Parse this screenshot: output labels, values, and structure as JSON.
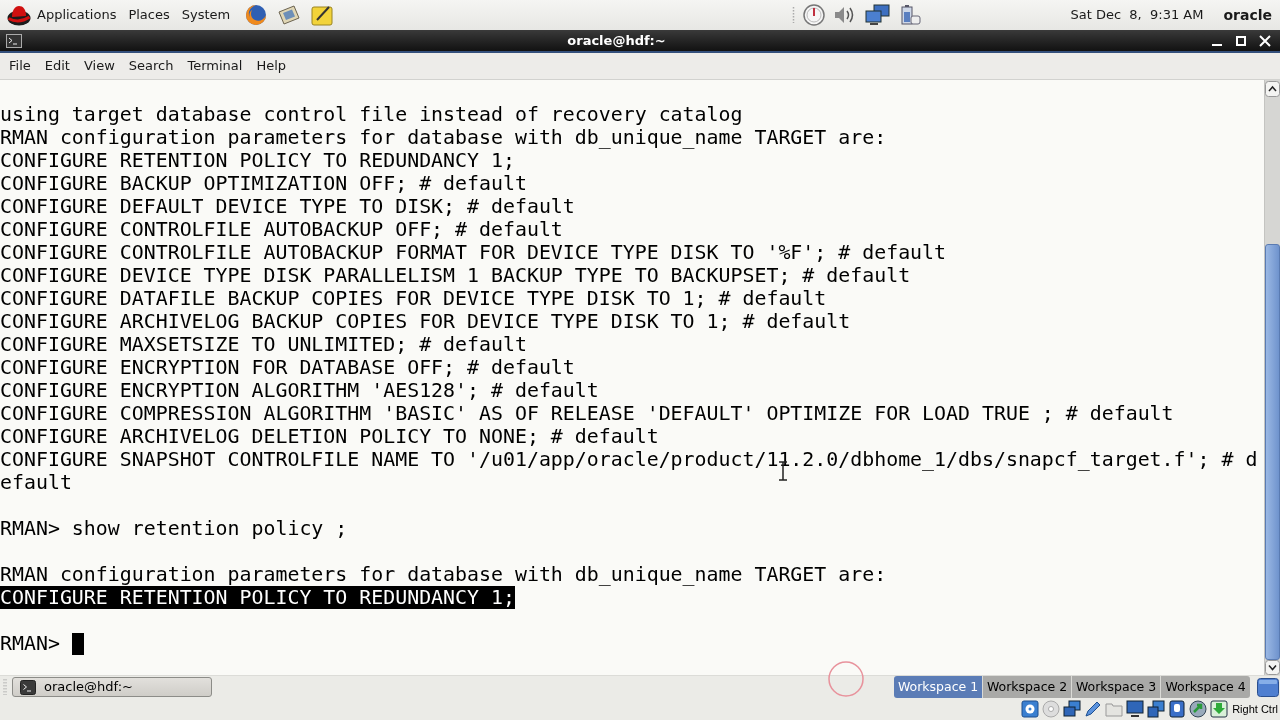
{
  "top_panel": {
    "menus": [
      "Applications",
      "Places",
      "System"
    ],
    "clock": "Sat Dec  8,  9:31 AM",
    "user": "oracle"
  },
  "window": {
    "title": "oracle@hdf:~"
  },
  "menu_bar": [
    "File",
    "Edit",
    "View",
    "Search",
    "Terminal",
    "Help"
  ],
  "terminal": {
    "lines": [
      {
        "kind": "text",
        "text": "using target database control file instead of recovery catalog",
        "selected": false
      },
      {
        "kind": "text",
        "text": "RMAN configuration parameters for database with db_unique_name TARGET are:",
        "selected": false
      },
      {
        "kind": "text",
        "text": "CONFIGURE RETENTION POLICY TO REDUNDANCY 1;",
        "selected": false
      },
      {
        "kind": "text",
        "text": "CONFIGURE BACKUP OPTIMIZATION OFF; # default",
        "selected": false
      },
      {
        "kind": "text",
        "text": "CONFIGURE DEFAULT DEVICE TYPE TO DISK; # default",
        "selected": false
      },
      {
        "kind": "text",
        "text": "CONFIGURE CONTROLFILE AUTOBACKUP OFF; # default",
        "selected": false
      },
      {
        "kind": "text",
        "text": "CONFIGURE CONTROLFILE AUTOBACKUP FORMAT FOR DEVICE TYPE DISK TO '%F'; # default",
        "selected": false
      },
      {
        "kind": "text",
        "text": "CONFIGURE DEVICE TYPE DISK PARALLELISM 1 BACKUP TYPE TO BACKUPSET; # default",
        "selected": false
      },
      {
        "kind": "text",
        "text": "CONFIGURE DATAFILE BACKUP COPIES FOR DEVICE TYPE DISK TO 1; # default",
        "selected": false
      },
      {
        "kind": "text",
        "text": "CONFIGURE ARCHIVELOG BACKUP COPIES FOR DEVICE TYPE DISK TO 1; # default",
        "selected": false
      },
      {
        "kind": "text",
        "text": "CONFIGURE MAXSETSIZE TO UNLIMITED; # default",
        "selected": false
      },
      {
        "kind": "text",
        "text": "CONFIGURE ENCRYPTION FOR DATABASE OFF; # default",
        "selected": false
      },
      {
        "kind": "text",
        "text": "CONFIGURE ENCRYPTION ALGORITHM 'AES128'; # default",
        "selected": false
      },
      {
        "kind": "text",
        "text": "CONFIGURE COMPRESSION ALGORITHM 'BASIC' AS OF RELEASE 'DEFAULT' OPTIMIZE FOR LOAD TRUE ; # default",
        "selected": false
      },
      {
        "kind": "text",
        "text": "CONFIGURE ARCHIVELOG DELETION POLICY TO NONE; # default",
        "selected": false
      },
      {
        "kind": "text",
        "text": "CONFIGURE SNAPSHOT CONTROLFILE NAME TO '/u01/app/oracle/product/11.2.0/dbhome_1/dbs/snapcf_target.f'; # d",
        "selected": false
      },
      {
        "kind": "text",
        "text": "efault",
        "selected": false
      },
      {
        "kind": "blank"
      },
      {
        "kind": "text",
        "text": "RMAN> show retention policy ;",
        "selected": false
      },
      {
        "kind": "blank"
      },
      {
        "kind": "text",
        "text": "RMAN configuration parameters for database with db_unique_name TARGET are:",
        "selected": false
      },
      {
        "kind": "text",
        "text": "CONFIGURE RETENTION POLICY TO REDUNDANCY 1;",
        "selected": true
      },
      {
        "kind": "blank"
      },
      {
        "kind": "prompt",
        "text": "RMAN>",
        "selected": false
      }
    ]
  },
  "taskbar": {
    "tasks": [
      {
        "label": "oracle@hdf:~"
      }
    ],
    "workspaces": [
      {
        "label": "Workspace 1",
        "selected": true
      },
      {
        "label": "Workspace 2",
        "selected": false
      },
      {
        "label": "Workspace 3",
        "selected": false
      },
      {
        "label": "Workspace 4",
        "selected": false
      }
    ]
  },
  "status_bar": {
    "host_key": "Right Ctrl"
  }
}
